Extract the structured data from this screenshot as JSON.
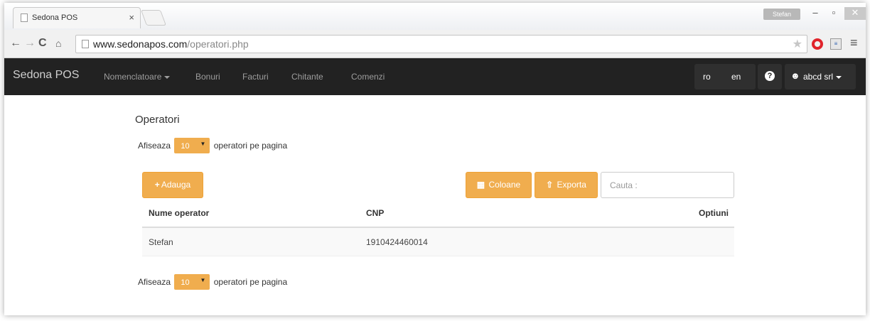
{
  "browser": {
    "tab_title": "Sedona POS",
    "tab_close": "×",
    "url_host": "www.sedonapos.com",
    "url_path": "/operatori.php",
    "window_user": "Stefan"
  },
  "navbar": {
    "brand": "Sedona POS",
    "links": [
      "Nomenclatoare",
      "Bonuri",
      "Facturi",
      "Chitante",
      "Comenzi"
    ],
    "lang_ro": "ro",
    "lang_en": "en",
    "help": "?",
    "user": "abcd srl"
  },
  "page": {
    "title": "Operatori",
    "perpage_prefix": "Afiseaza",
    "perpage_value": "10",
    "perpage_suffix": "operatori pe pagina",
    "add_button": "Adauga",
    "columns_button": "Coloane",
    "export_button": "Exporta",
    "search_placeholder": "Cauta :"
  },
  "table": {
    "headers": [
      "Nume operator",
      "CNP",
      "Optiuni"
    ],
    "rows": [
      {
        "name": "Stefan",
        "cnp": "1910424460014"
      }
    ]
  },
  "colors": {
    "accent": "#f0ad4e",
    "navbar": "#222222"
  }
}
